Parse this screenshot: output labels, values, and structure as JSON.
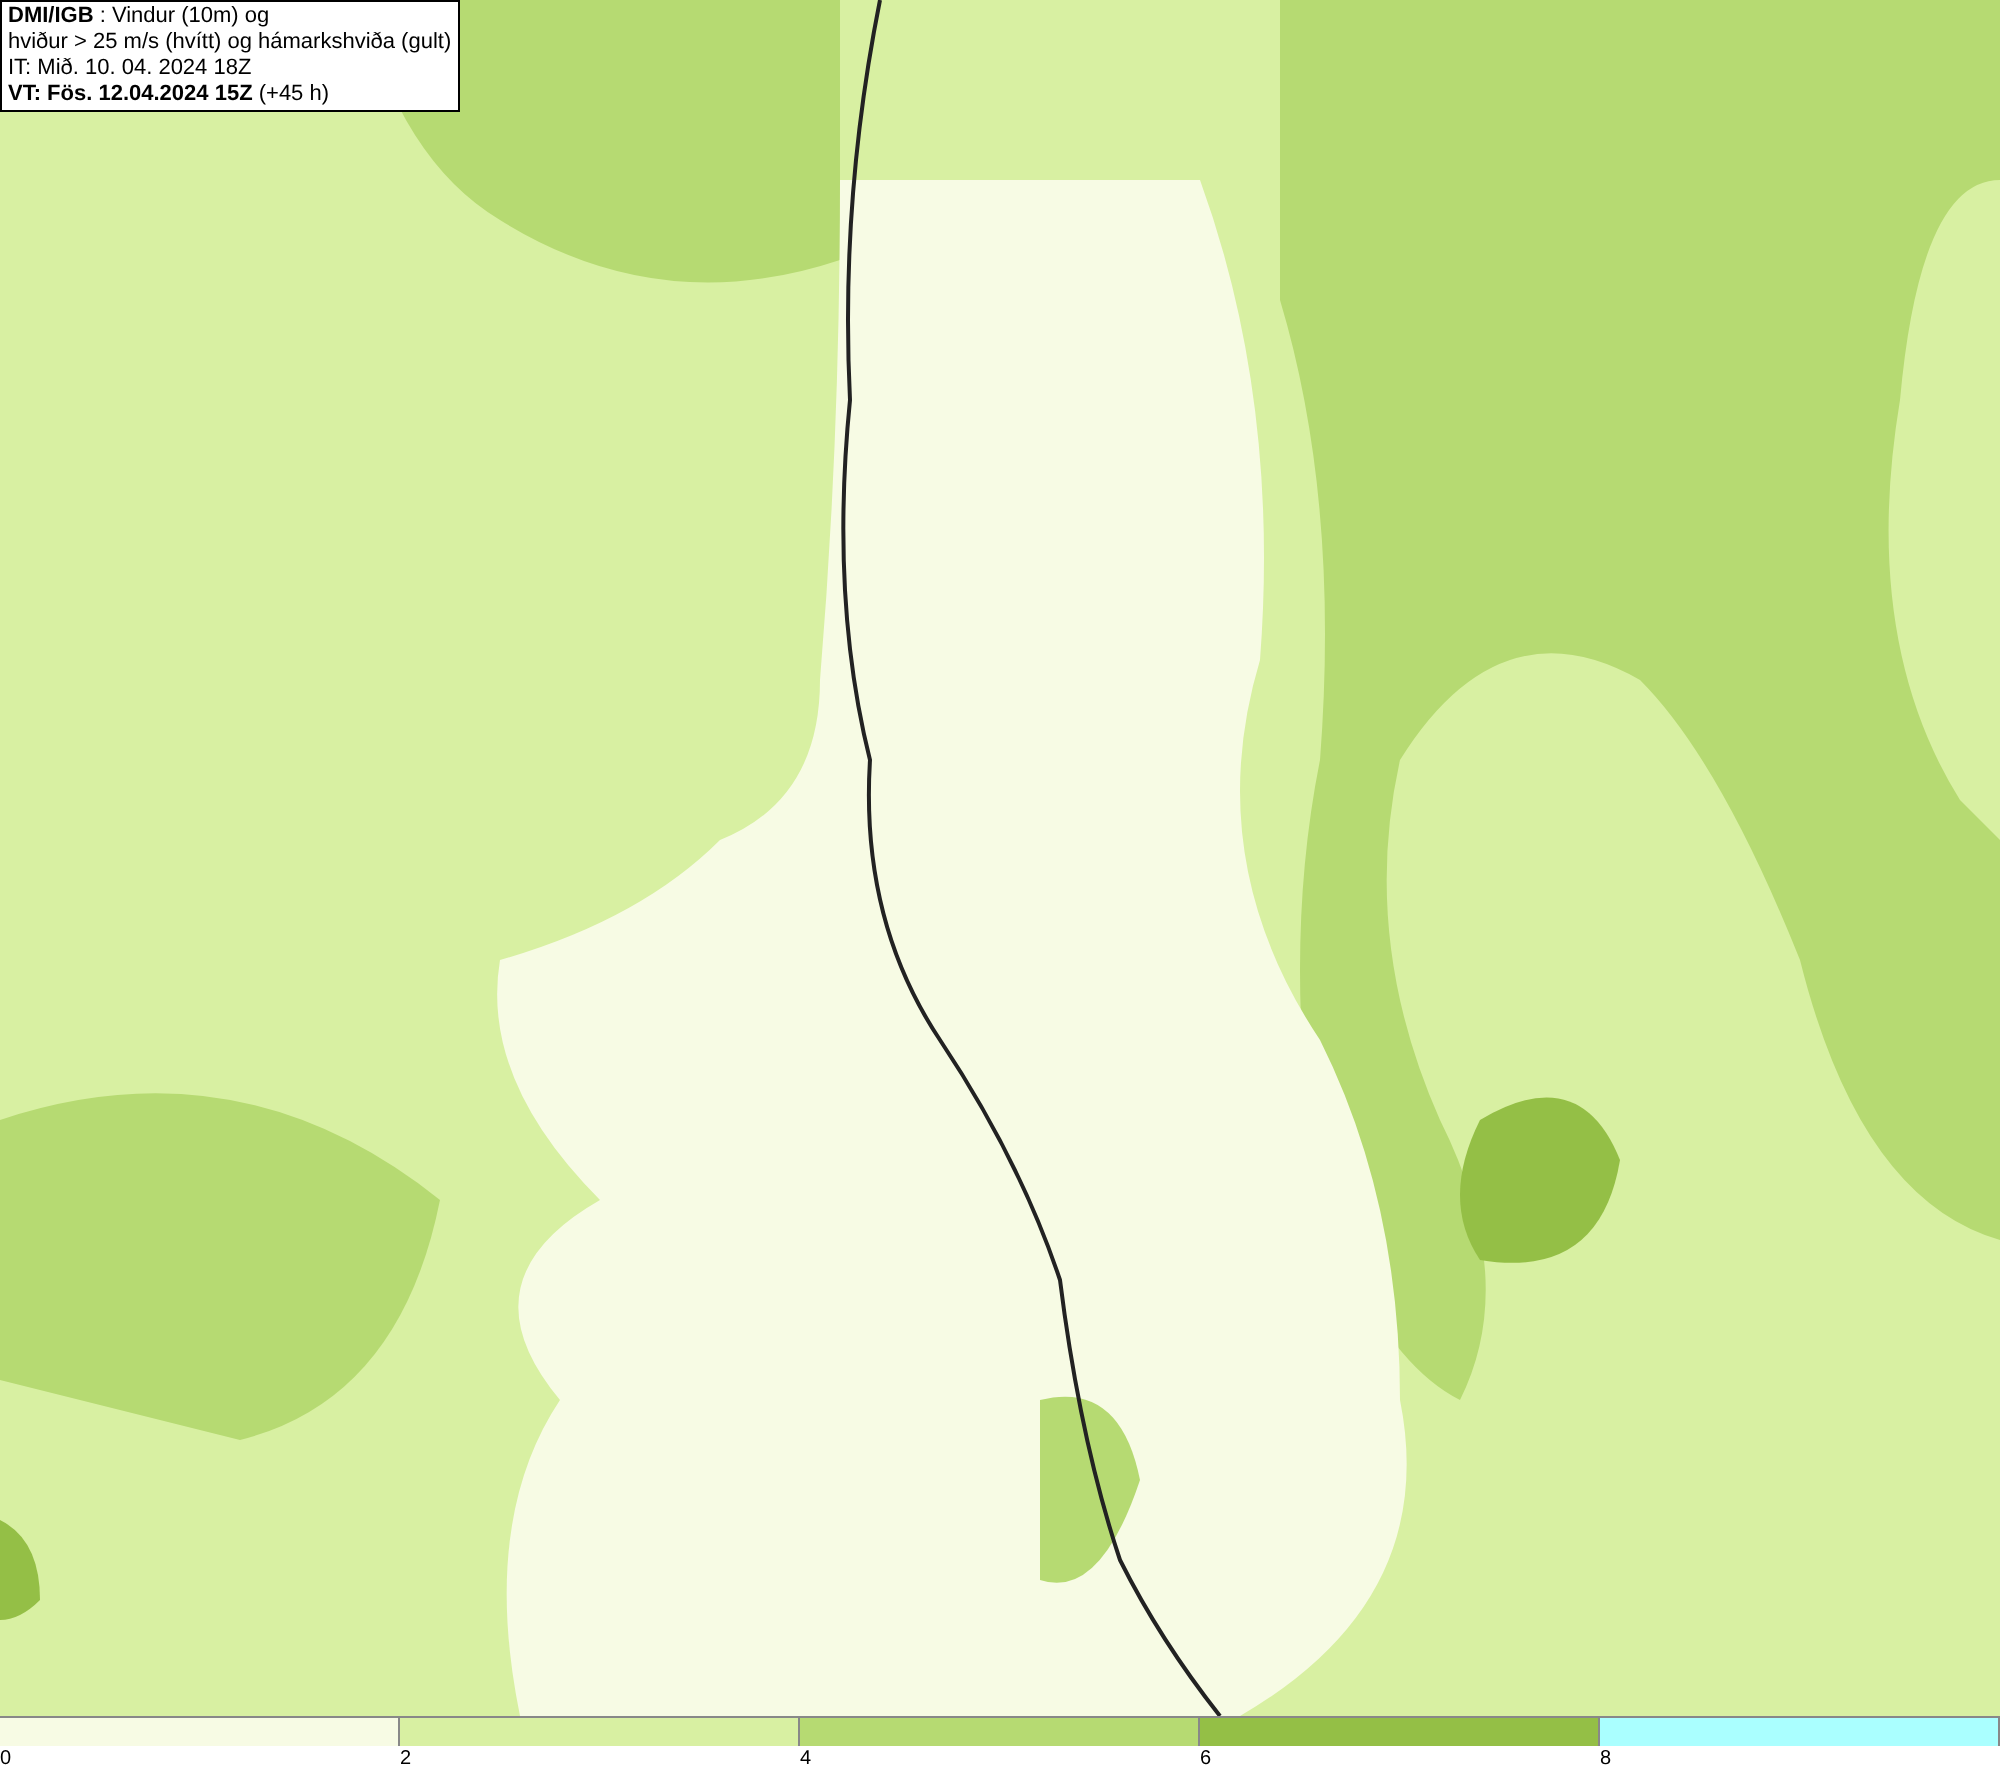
{
  "info_box": {
    "lines": [
      "**DMI/IGB** : Vindur (10m) og",
      "hviður > 25 m/s (hvítt) og hámarkshviða (gult)",
      "IT: Mið. 10. 04. 2024 18Z",
      "**VT: Fös. 12.04.2024 15Z** (+45 h)"
    ]
  },
  "color_scale": [
    {
      "label": "0",
      "color": "#f7fbe4"
    },
    {
      "label": "2",
      "color": "#d8f0a2"
    },
    {
      "label": "4",
      "color": "#b6da72"
    },
    {
      "label": "6",
      "color": "#94bf46"
    },
    {
      "label": "8",
      "color": "#aaffff"
    }
  ]
}
